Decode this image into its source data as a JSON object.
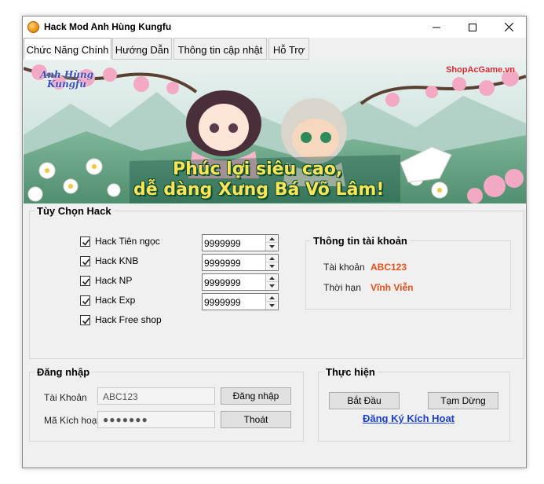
{
  "window": {
    "title": "Hack Mod Anh Hùng Kungfu"
  },
  "tabs": [
    {
      "label": "Chức Năng Chính"
    },
    {
      "label": "Hướng Dẫn"
    },
    {
      "label": "Thông tin cập nhật"
    },
    {
      "label": "Hỗ Trợ"
    }
  ],
  "banner": {
    "logo_text": "Anh Hùng Kungfu",
    "site_text": "ShopAcGame.vn",
    "slogan_line1": "Phúc lợi siêu cao,",
    "slogan_line2": "dễ dàng Xưng Bá Võ Lâm!"
  },
  "hack_options": {
    "title": "Tùy Chọn Hack",
    "items": [
      {
        "label": "Hack Tiên ngọc",
        "checked": true,
        "value": "9999999"
      },
      {
        "label": "Hack KNB",
        "checked": true,
        "value": "9999999"
      },
      {
        "label": "Hack NP",
        "checked": true,
        "value": "9999999"
      },
      {
        "label": "Hack Exp",
        "checked": true,
        "value": "9999999"
      },
      {
        "label": "Hack Free shop",
        "checked": true
      }
    ]
  },
  "account_info": {
    "title": "Thông tin tài khoản",
    "account_label": "Tài khoản",
    "account_value": "ABC123",
    "duration_label": "Thời hạn",
    "duration_value": "Vĩnh Viễn"
  },
  "login": {
    "title": "Đăng nhập",
    "account_label": "Tài Khoản",
    "account_value": "ABC123",
    "code_label": "Mã Kích hoạt",
    "code_value": "●●●●●●●",
    "login_button": "Đăng nhập",
    "exit_button": "Thoát"
  },
  "execute": {
    "title": "Thực hiện",
    "start_button": "Bắt Đầu",
    "pause_button": "Tạm Dừng",
    "register_link": "Đăng Ký Kích Hoạt"
  },
  "colors": {
    "accent_orange": "#e8501a",
    "link_blue": "#1a3fd0"
  }
}
